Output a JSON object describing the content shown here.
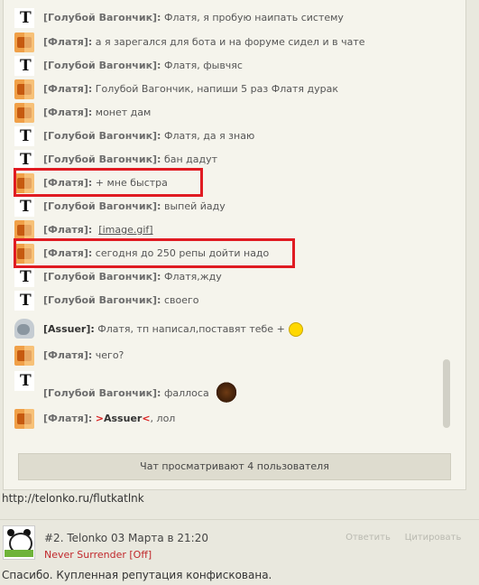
{
  "chat": {
    "messages": [
      {
        "avatar": "t-icon",
        "nick": "[Голубой Вагончик]:",
        "text": "Флатя, я пробую наипать систему"
      },
      {
        "avatar": "fox-icon",
        "nick": "[Флатя]:",
        "text": "а я зарегался для бота и на форуме сидел и в чате"
      },
      {
        "avatar": "t-icon",
        "nick": "[Голубой Вагончик]:",
        "text": "Флатя, фывчяс"
      },
      {
        "avatar": "fox-icon",
        "nick": "[Флатя]:",
        "text": "Голубой Вагончик, напиши 5 раз Флатя дурак"
      },
      {
        "avatar": "fox-icon",
        "nick": "[Флатя]:",
        "text": "монет дам"
      },
      {
        "avatar": "t-icon",
        "nick": "[Голубой Вагончик]:",
        "text": "Флатя, да я знаю"
      },
      {
        "avatar": "t-icon",
        "nick": "[Голубой Вагончик]:",
        "text": "бан дадут"
      },
      {
        "avatar": "fox-icon",
        "nick": "[Флатя]:",
        "text": "+ мне быстра"
      },
      {
        "avatar": "t-icon",
        "nick": "[Голубой Вагончик]:",
        "text": "выпей йаду"
      },
      {
        "avatar": "fox-icon",
        "nick": "[Флатя]:",
        "text": "[image.gif]"
      },
      {
        "avatar": "fox-icon",
        "nick": "[Флатя]:",
        "text": "сегодня до 250 репы дойти надо"
      },
      {
        "avatar": "t-icon",
        "nick": "[Голубой Вагончик]:",
        "text": "Флатя,жду"
      },
      {
        "avatar": "t-icon",
        "nick": "[Голубой Вагончик]:",
        "text": "своего"
      },
      {
        "avatar": "mouse-icon",
        "nick": "[Assuer]:",
        "text": "Флатя, тп написал,поставят тебе +"
      },
      {
        "avatar": "fox-icon",
        "nick": "[Флатя]:",
        "text": "чего?"
      },
      {
        "avatar": "t-icon",
        "nick": "[Голубой Вагончик]:",
        "text": "фаллоса"
      },
      {
        "avatar": "fox-icon",
        "nick": "[Флатя]:",
        "mention_open": ">",
        "mention": "Assuer",
        "mention_close": "<",
        "text": ", лол"
      }
    ],
    "viewers_text": "Чат просматривают 4 пользователя"
  },
  "url_text": "http://telonko.ru/flutkatlnk",
  "post": {
    "title": "#2. Telonko 03 Марта в 21:20",
    "status": "Never Surrender [Off]",
    "reply_label": "Ответить",
    "quote_label": "Цитировать",
    "body": "Спасибо. Купленная репутация конфискована."
  },
  "colors": {
    "highlight_box": "#e01b22",
    "mention": "#d81e1e",
    "status": "#c0282c"
  }
}
